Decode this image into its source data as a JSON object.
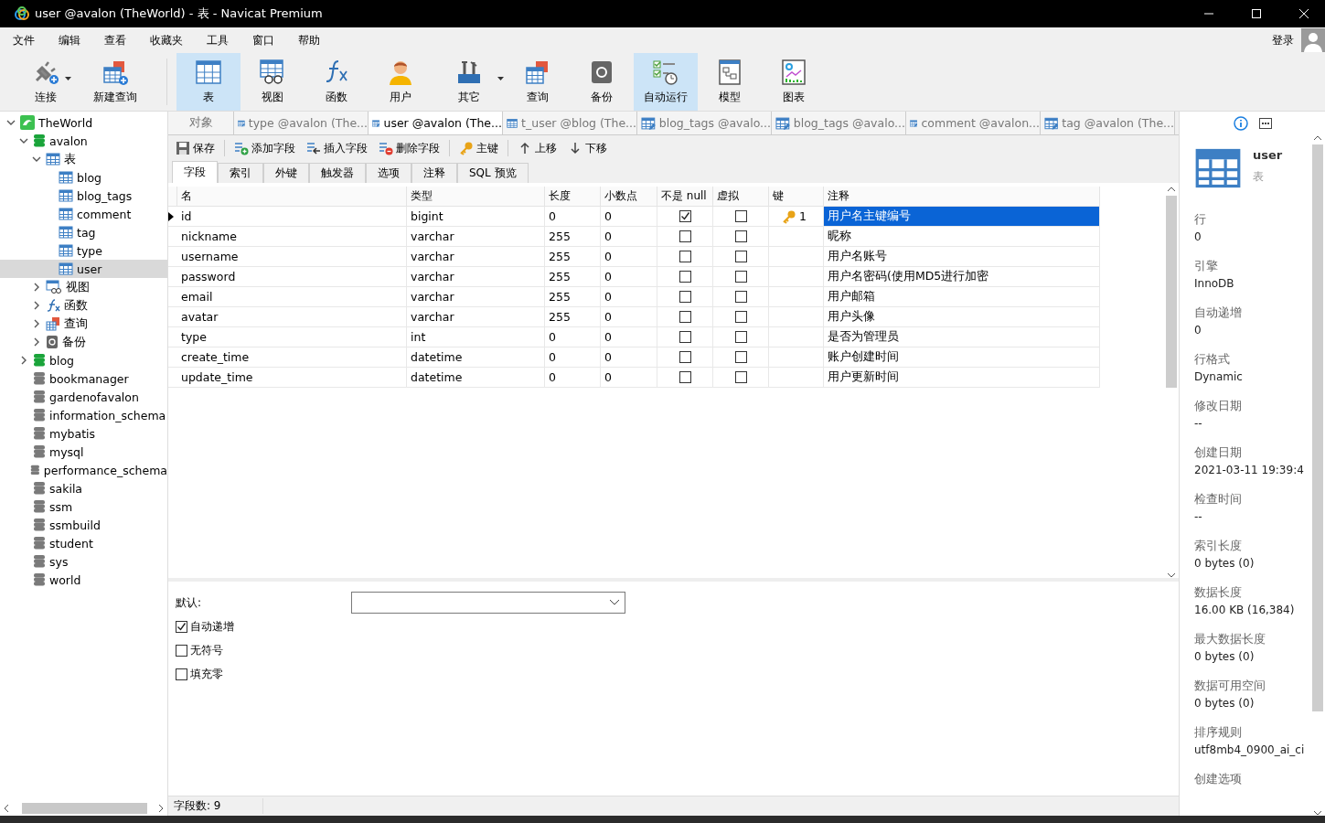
{
  "window": {
    "title": "user @avalon (TheWorld) - 表 - Navicat Premium"
  },
  "menu": [
    "文件",
    "编辑",
    "查看",
    "收藏夹",
    "工具",
    "窗口",
    "帮助"
  ],
  "login": "登录",
  "toolbar": [
    {
      "label": "连接",
      "kind": "connect",
      "selected": false,
      "dropdown": true
    },
    {
      "label": "新建查询",
      "kind": "new-query",
      "selected": false,
      "dropdown": false
    },
    {
      "label": "表",
      "kind": "table",
      "selected": true,
      "dropdown": false
    },
    {
      "label": "视图",
      "kind": "view",
      "selected": false,
      "dropdown": false
    },
    {
      "label": "函数",
      "kind": "function",
      "selected": false,
      "dropdown": false
    },
    {
      "label": "用户",
      "kind": "user",
      "selected": false,
      "dropdown": false
    },
    {
      "label": "其它",
      "kind": "tools",
      "selected": false,
      "dropdown": true
    },
    {
      "label": "查询",
      "kind": "query",
      "selected": false,
      "dropdown": false
    },
    {
      "label": "备份",
      "kind": "backup",
      "selected": false,
      "dropdown": false
    },
    {
      "label": "自动运行",
      "kind": "automation",
      "selected": true,
      "dropdown": false
    },
    {
      "label": "模型",
      "kind": "model",
      "selected": false,
      "dropdown": false
    },
    {
      "label": "图表",
      "kind": "chart",
      "selected": false,
      "dropdown": false
    }
  ],
  "tree": [
    {
      "label": "TheWorld",
      "kind": "connection",
      "expanded": true,
      "selected": false,
      "children": [
        {
          "label": "avalon",
          "kind": "database",
          "connected": true,
          "expanded": true,
          "selected": false,
          "children": [
            {
              "label": "表",
              "kind": "tables",
              "expanded": true,
              "selected": false,
              "children": [
                {
                  "label": "blog",
                  "kind": "table",
                  "selected": false
                },
                {
                  "label": "blog_tags",
                  "kind": "table",
                  "selected": false
                },
                {
                  "label": "comment",
                  "kind": "table",
                  "selected": false
                },
                {
                  "label": "tag",
                  "kind": "table",
                  "selected": false
                },
                {
                  "label": "type",
                  "kind": "table",
                  "selected": false
                },
                {
                  "label": "user",
                  "kind": "table",
                  "selected": true
                }
              ]
            },
            {
              "label": "视图",
              "kind": "views",
              "expanded": false,
              "selected": false
            },
            {
              "label": "函数",
              "kind": "functions",
              "expanded": false,
              "selected": false
            },
            {
              "label": "查询",
              "kind": "queries",
              "expanded": false,
              "selected": false
            },
            {
              "label": "备份",
              "kind": "backups",
              "expanded": false,
              "selected": false
            }
          ]
        },
        {
          "label": "blog",
          "kind": "database",
          "connected": true,
          "expanded": false,
          "selected": false
        },
        {
          "label": "bookmanager",
          "kind": "database",
          "connected": false,
          "selected": false
        },
        {
          "label": "gardenofavalon",
          "kind": "database",
          "connected": false,
          "selected": false
        },
        {
          "label": "information_schema",
          "kind": "database",
          "connected": false,
          "selected": false
        },
        {
          "label": "mybatis",
          "kind": "database",
          "connected": false,
          "selected": false
        },
        {
          "label": "mysql",
          "kind": "database",
          "connected": false,
          "selected": false
        },
        {
          "label": "performance_schema",
          "kind": "database",
          "connected": false,
          "selected": false
        },
        {
          "label": "sakila",
          "kind": "database",
          "connected": false,
          "selected": false
        },
        {
          "label": "ssm",
          "kind": "database",
          "connected": false,
          "selected": false
        },
        {
          "label": "ssmbuild",
          "kind": "database",
          "connected": false,
          "selected": false
        },
        {
          "label": "student",
          "kind": "database",
          "connected": false,
          "selected": false
        },
        {
          "label": "sys",
          "kind": "database",
          "connected": false,
          "selected": false
        },
        {
          "label": "world",
          "kind": "database",
          "connected": false,
          "selected": false
        }
      ]
    }
  ],
  "doc_tabs": [
    {
      "label": "对象",
      "kind": "plain",
      "selected": false
    },
    {
      "label": "type @avalon (The...",
      "kind": "table-edit",
      "selected": false
    },
    {
      "label": "user @avalon (The...",
      "kind": "table-edit",
      "selected": true
    },
    {
      "label": "t_user @blog (The...",
      "kind": "table",
      "selected": false
    },
    {
      "label": "blog_tags @avalo...",
      "kind": "table-edit",
      "selected": false
    },
    {
      "label": "blog_tags @avalo...",
      "kind": "table-edit",
      "selected": false
    },
    {
      "label": "comment @avalon...",
      "kind": "table-edit",
      "selected": false
    },
    {
      "label": "tag @avalon (The...",
      "kind": "table-edit",
      "selected": false
    }
  ],
  "actions": [
    {
      "label": "保存",
      "kind": "save"
    },
    {
      "label": "添加字段",
      "kind": "add-field"
    },
    {
      "label": "插入字段",
      "kind": "insert-field"
    },
    {
      "label": "删除字段",
      "kind": "delete-field"
    },
    {
      "label": "主键",
      "kind": "key"
    },
    {
      "label": "上移",
      "kind": "up"
    },
    {
      "label": "下移",
      "kind": "down"
    }
  ],
  "sub_tabs": [
    {
      "label": "字段",
      "selected": true
    },
    {
      "label": "索引",
      "selected": false
    },
    {
      "label": "外键",
      "selected": false
    },
    {
      "label": "触发器",
      "selected": false
    },
    {
      "label": "选项",
      "selected": false
    },
    {
      "label": "注释",
      "selected": false
    },
    {
      "label": "SQL 预览",
      "selected": false
    }
  ],
  "columns": [
    "名",
    "类型",
    "长度",
    "小数点",
    "不是 null",
    "虚拟",
    "键",
    "注释"
  ],
  "fields": [
    {
      "name": "id",
      "type": "bigint",
      "length": "0",
      "decimals": "0",
      "not_null": true,
      "virtual": false,
      "key": "1",
      "comment": "用户名主键编号",
      "selected": true
    },
    {
      "name": "nickname",
      "type": "varchar",
      "length": "255",
      "decimals": "0",
      "not_null": false,
      "virtual": false,
      "comment": "昵称",
      "selected": false
    },
    {
      "name": "username",
      "type": "varchar",
      "length": "255",
      "decimals": "0",
      "not_null": false,
      "virtual": false,
      "comment": "用户名账号",
      "selected": false
    },
    {
      "name": "password",
      "type": "varchar",
      "length": "255",
      "decimals": "0",
      "not_null": false,
      "virtual": false,
      "comment": "用户名密码(使用MD5进行加密",
      "selected": false
    },
    {
      "name": "email",
      "type": "varchar",
      "length": "255",
      "decimals": "0",
      "not_null": false,
      "virtual": false,
      "comment": "用户邮箱",
      "selected": false
    },
    {
      "name": "avatar",
      "type": "varchar",
      "length": "255",
      "decimals": "0",
      "not_null": false,
      "virtual": false,
      "comment": "用户头像",
      "selected": false
    },
    {
      "name": "type",
      "type": "int",
      "length": "0",
      "decimals": "0",
      "not_null": false,
      "virtual": false,
      "comment": "是否为管理员",
      "selected": false
    },
    {
      "name": "create_time",
      "type": "datetime",
      "length": "0",
      "decimals": "0",
      "not_null": false,
      "virtual": false,
      "comment": "账户创建时间",
      "selected": false
    },
    {
      "name": "update_time",
      "type": "datetime",
      "length": "0",
      "decimals": "0",
      "not_null": false,
      "virtual": false,
      "comment": "用户更新时间",
      "selected": false
    }
  ],
  "properties": {
    "default_label": "默认:",
    "options": [
      {
        "label": "自动递增",
        "checked": true
      },
      {
        "label": "无符号",
        "checked": false
      },
      {
        "label": "填充零",
        "checked": false
      }
    ]
  },
  "status_bar": "字段数: 9",
  "info": {
    "name": "user",
    "subtitle": "表",
    "items": [
      {
        "label": "行",
        "value": "0"
      },
      {
        "label": "引擎",
        "value": "InnoDB"
      },
      {
        "label": "自动递增",
        "value": "0"
      },
      {
        "label": "行格式",
        "value": "Dynamic"
      },
      {
        "label": "修改日期",
        "value": "--"
      },
      {
        "label": "创建日期",
        "value": "2021-03-11 19:39:4"
      },
      {
        "label": "检查时间",
        "value": "--"
      },
      {
        "label": "索引长度",
        "value": "0 bytes (0)"
      },
      {
        "label": "数据长度",
        "value": "16.00 KB (16,384)"
      },
      {
        "label": "最大数据长度",
        "value": "0 bytes (0)"
      },
      {
        "label": "数据可用空间",
        "value": "0 bytes (0)"
      },
      {
        "label": "排序规则",
        "value": "utf8mb4_0900_ai_ci"
      },
      {
        "label": "创建选项"
      }
    ]
  }
}
